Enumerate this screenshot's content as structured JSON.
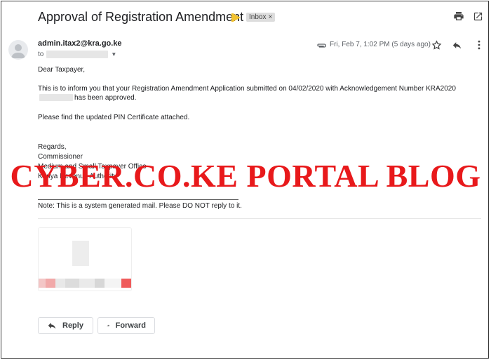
{
  "email": {
    "subject": "Approval of Registration Amendment",
    "label": "Inbox",
    "label_close": "×",
    "sender": "admin.itax2@kra.go.ke",
    "to_prefix": "to",
    "date": "Fri, Feb 7, 1:02 PM (5 days ago)",
    "greeting": "Dear Taxpayer,",
    "main_text": "This is to inform you that your Registration Amendment Application submitted on 04/02/2020 with Acknowledgement Number KRA2020",
    "main_text_end": "has been approved.",
    "find_text": "Please find the updated PIN Certificate attached.",
    "regards": "Regards,",
    "commissioner": "Commissioner",
    "office": "Medium and Small Taxpayer Office",
    "authority": "Kenya Revenue Authority",
    "note": "Note: This is a system generated mail. Please DO NOT reply to it."
  },
  "watermark": "CYBER.CO.KE PORTAL BLOG",
  "actions": {
    "reply_label": "Reply",
    "forward_label": "Forward"
  },
  "icons": {
    "print": "print-icon",
    "open_new": "open-in-new-window-icon",
    "star": "star-icon",
    "reply": "reply-icon",
    "more": "more-vert-icon",
    "attachment": "attachment-icon",
    "avatar": "avatar-icon"
  },
  "colors": {
    "watermark": "#e8191b",
    "importance_marker": "#f2c230",
    "label_chip": "#dddddd"
  }
}
